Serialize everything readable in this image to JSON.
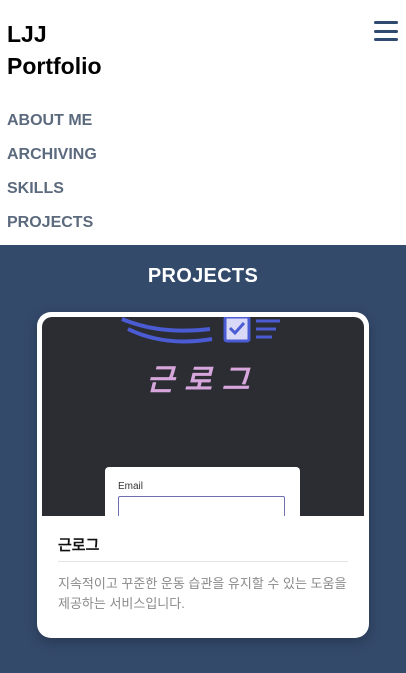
{
  "header": {
    "brand_line1": "LJJ",
    "brand_line2": "Portfolio",
    "menu_icon": "hamburger-menu-icon"
  },
  "nav": {
    "items": [
      {
        "label": "ABOUT ME"
      },
      {
        "label": "ARCHIVING"
      },
      {
        "label": "SKILLS"
      },
      {
        "label": "PROJECTS"
      }
    ]
  },
  "projects": {
    "title": "PROJECTS",
    "cards": [
      {
        "image_logo_text": "근로그",
        "image_form_label": "Email",
        "title": "근로그",
        "description": "지속적이고 꾸준한 운동 습관을 유지할 수 있는 도움을 제공하는 서비스입니다."
      }
    ]
  },
  "colors": {
    "section_bg": "#344a6b",
    "nav_text": "#5c6a7e",
    "menu_icon": "#2f4a6f",
    "logo_text": "#d6a6dc"
  }
}
